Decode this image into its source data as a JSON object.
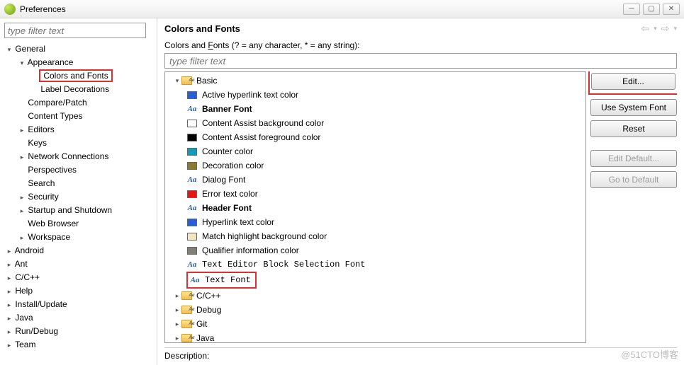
{
  "window": {
    "title": "Preferences"
  },
  "left": {
    "filter_placeholder": "type filter text",
    "tree": [
      {
        "lvl": 0,
        "tw": "▾",
        "label": "General",
        "n": "general"
      },
      {
        "lvl": 1,
        "tw": "▾",
        "label": "Appearance",
        "n": "appearance"
      },
      {
        "lvl": 2,
        "tw": "",
        "label": "Colors and Fonts",
        "n": "colors-fonts",
        "sel": true
      },
      {
        "lvl": 2,
        "tw": "",
        "label": "Label Decorations",
        "n": "label-decorations"
      },
      {
        "lvl": 1,
        "tw": "",
        "label": "Compare/Patch",
        "n": "compare"
      },
      {
        "lvl": 1,
        "tw": "",
        "label": "Content Types",
        "n": "content-types"
      },
      {
        "lvl": 1,
        "tw": "▸",
        "label": "Editors",
        "n": "editors"
      },
      {
        "lvl": 1,
        "tw": "",
        "label": "Keys",
        "n": "keys"
      },
      {
        "lvl": 1,
        "tw": "▸",
        "label": "Network Connections",
        "n": "network"
      },
      {
        "lvl": 1,
        "tw": "",
        "label": "Perspectives",
        "n": "perspectives"
      },
      {
        "lvl": 1,
        "tw": "",
        "label": "Search",
        "n": "search"
      },
      {
        "lvl": 1,
        "tw": "▸",
        "label": "Security",
        "n": "security"
      },
      {
        "lvl": 1,
        "tw": "▸",
        "label": "Startup and Shutdown",
        "n": "startup"
      },
      {
        "lvl": 1,
        "tw": "",
        "label": "Web Browser",
        "n": "web-browser"
      },
      {
        "lvl": 1,
        "tw": "▸",
        "label": "Workspace",
        "n": "workspace"
      },
      {
        "lvl": 0,
        "tw": "▸",
        "label": "Android",
        "n": "android"
      },
      {
        "lvl": 0,
        "tw": "▸",
        "label": "Ant",
        "n": "ant"
      },
      {
        "lvl": 0,
        "tw": "▸",
        "label": "C/C++",
        "n": "cpp"
      },
      {
        "lvl": 0,
        "tw": "▸",
        "label": "Help",
        "n": "help"
      },
      {
        "lvl": 0,
        "tw": "▸",
        "label": "Install/Update",
        "n": "install"
      },
      {
        "lvl": 0,
        "tw": "▸",
        "label": "Java",
        "n": "java"
      },
      {
        "lvl": 0,
        "tw": "▸",
        "label": "Run/Debug",
        "n": "rundebug"
      },
      {
        "lvl": 0,
        "tw": "▸",
        "label": "Team",
        "n": "team"
      }
    ]
  },
  "right": {
    "heading": "Colors and Fonts",
    "desc_prefix": "Colors and ",
    "desc_u": "F",
    "desc_rest": "onts (? = any character, * = any string):",
    "filter_placeholder": "type filter text",
    "buttons": {
      "edit": "Edit...",
      "use_system": "Use System Font",
      "reset": "Reset",
      "edit_default": "Edit Default...",
      "go_default": "Go to Default"
    },
    "footer_label": "Description:",
    "items": [
      {
        "type": "group",
        "tw": "▾",
        "label": "Basic",
        "n": "basic"
      },
      {
        "type": "color",
        "color": "#2a5fd4",
        "label": "Active hyperlink text color",
        "n": "active-hyperlink"
      },
      {
        "type": "font",
        "label": "Banner Font",
        "bold": true,
        "n": "banner-font"
      },
      {
        "type": "empty",
        "label": "Content Assist background color",
        "n": "ca-bg"
      },
      {
        "type": "color",
        "color": "#000000",
        "label": "Content Assist foreground color",
        "n": "ca-fg"
      },
      {
        "type": "color",
        "color": "#1a99b5",
        "label": "Counter color",
        "n": "counter"
      },
      {
        "type": "color",
        "color": "#8a7b32",
        "label": "Decoration color",
        "n": "decoration"
      },
      {
        "type": "font",
        "label": "Dialog Font",
        "n": "dialog-font"
      },
      {
        "type": "color",
        "color": "#e41616",
        "label": "Error text color",
        "n": "error"
      },
      {
        "type": "font",
        "label": "Header Font",
        "bold": true,
        "n": "header-font"
      },
      {
        "type": "color",
        "color": "#2a5fd4",
        "label": "Hyperlink text color",
        "n": "hyperlink"
      },
      {
        "type": "color",
        "color": "#f1e7c6",
        "label": "Match highlight background color",
        "n": "match-bg"
      },
      {
        "type": "color",
        "color": "#827f7a",
        "label": "Qualifier information color",
        "n": "qualifier"
      },
      {
        "type": "font",
        "label": "Text Editor Block Selection Font",
        "mono": true,
        "n": "block-font"
      },
      {
        "type": "font",
        "label": "Text Font",
        "mono": true,
        "n": "text-font",
        "hl": true
      },
      {
        "type": "group",
        "tw": "▸",
        "label": "C/C++",
        "n": "g-cpp"
      },
      {
        "type": "group",
        "tw": "▸",
        "label": "Debug",
        "n": "g-debug"
      },
      {
        "type": "group",
        "tw": "▸",
        "label": "Git",
        "n": "g-git"
      },
      {
        "type": "group",
        "tw": "▸",
        "label": "Java",
        "n": "g-java"
      }
    ]
  },
  "watermark": "@51CTO博客"
}
